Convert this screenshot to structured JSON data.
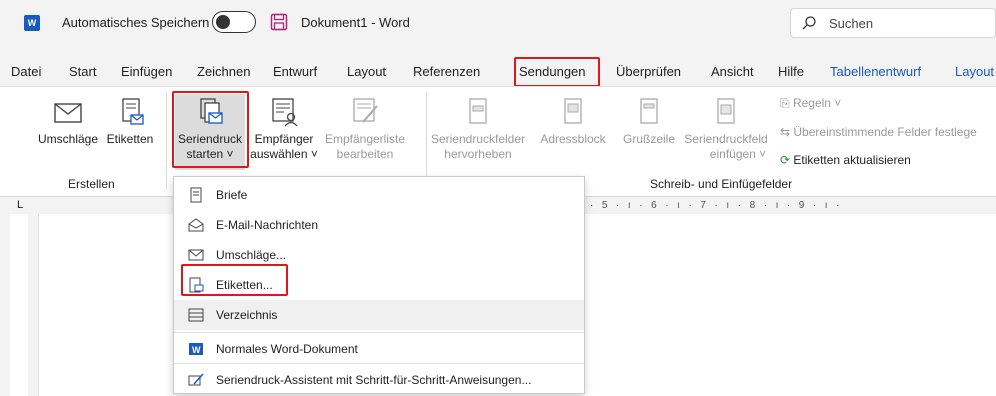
{
  "titlebar": {
    "autosave_label": "Automatisches Speichern",
    "toggle_state": "off",
    "document_title": "Dokument1  -  Word",
    "search_placeholder": "Suchen"
  },
  "tabs": [
    {
      "label": "Datei"
    },
    {
      "label": "Start"
    },
    {
      "label": "Einfügen"
    },
    {
      "label": "Zeichnen"
    },
    {
      "label": "Entwurf"
    },
    {
      "label": "Layout"
    },
    {
      "label": "Referenzen"
    },
    {
      "label": "Sendungen"
    },
    {
      "label": "Überprüfen"
    },
    {
      "label": "Ansicht"
    },
    {
      "label": "Hilfe"
    },
    {
      "label": "Tabellenentwurf"
    },
    {
      "label": "Layout"
    }
  ],
  "ribbon": {
    "erstellen": {
      "group_label": "Erstellen",
      "umschlaege": "Umschläge",
      "etiketten": "Etiketten"
    },
    "seriendruck": {
      "starten_line1": "Seriendruck",
      "starten_line2": "starten ˅",
      "empfaenger_line1": "Empfänger",
      "empfaenger_line2": "auswählen ˅",
      "liste_line1": "Empfängerliste",
      "liste_line2": "bearbeiten"
    },
    "schreib": {
      "group_label": "Schreib- und Einfügefelder",
      "felder_line1": "Seriendruckfelder",
      "felder_line2": "hervorheben",
      "adressblock": "Adressblock",
      "grusszeile": "Grußzeile",
      "feld_line1": "Seriendruckfeld",
      "feld_line2": "einfügen ˅",
      "regeln": "Regeln ˅",
      "uebereinstimmende": "Übereinstimmende Felder festlege",
      "etiketten_aktualisieren": "Etiketten aktualisieren"
    }
  },
  "ruler_text": "·  5  ·  ı  ·  6  ·  ı  ·  7  ·  ı  ·  8  ·  ı  ·  9  ·  ı  ·",
  "menu": {
    "items": [
      {
        "label": "Briefe",
        "icon": "letter-icon"
      },
      {
        "label": "E-Mail-Nachrichten",
        "icon": "email-icon"
      },
      {
        "label": "Umschläge...",
        "icon": "envelope-icon"
      },
      {
        "label": "Etiketten...",
        "icon": "labels-icon"
      },
      {
        "label": "Verzeichnis",
        "icon": "directory-icon"
      },
      {
        "label": "Normales Word-Dokument",
        "icon": "word-document-icon"
      },
      {
        "label": "Seriendruck-Assistent mit Schritt-für-Schritt-Anweisungen...",
        "icon": "wizard-icon"
      }
    ]
  },
  "colors": {
    "highlight_red": "#e0161d",
    "word_blue": "#185abd",
    "dim_text": "#9a9a9a"
  }
}
